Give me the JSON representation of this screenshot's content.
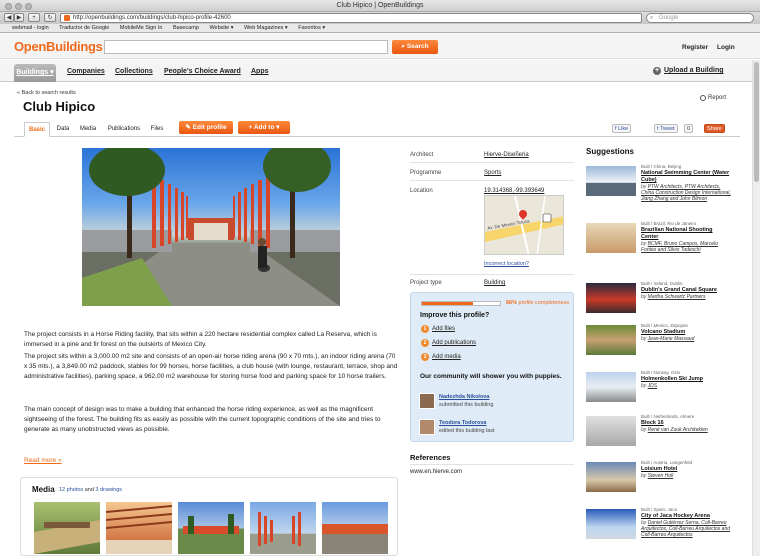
{
  "window": {
    "title": "Club Hipico | OpenBuildings"
  },
  "browser": {
    "url": "http://openbuildings.com/buildings/club-hipico-profile-42600",
    "search_placeholder": "Google",
    "bookmarks": [
      "webmail - login",
      "Traductor de Google",
      "MobileMe Sign In",
      "Basecamp",
      "Website ▾",
      "Web Magazines ▾",
      "Favoritos ▾"
    ]
  },
  "site": {
    "logo": "OpenBuildings",
    "search_label": "Search",
    "register": "Register",
    "login": "Login",
    "nav": [
      "Buildings",
      "Companies",
      "Collections",
      "People's Choice Award",
      "Apps"
    ],
    "upload": "Upload a Building"
  },
  "page": {
    "back": "« Back to search results",
    "title": "Club Hipico",
    "report": "Report",
    "tabs": [
      "Basic",
      "Data",
      "Media",
      "Publications",
      "Files"
    ],
    "edit_btn": "Edit profile",
    "add_btn": "Add to",
    "like": "Like",
    "tweet": "Tweet",
    "tweet_count": "0",
    "share": "Share"
  },
  "description": [
    "The project consists in a Horse Riding facility, that sits within a 220 hectare residential complex called La Reserva, which is immersed in a pine and fir forest on the outskirts of Mexico City.",
    "The project sits within a 3,000.00 m2 site and consists of an open-air horse riding arena (90 x 70 mts.), an indoor riding arena (70 x 35 mts.), a 3,849.00 m2 paddock, stables for 99 horses, horse facilities, a club house (with lounge, restaurant, terrace, shop and administrative facilities), parking space, a 962.00 m2 warehouse for storing horse food and parking space for 10 horse trailers.",
    "The main concept of design was to make a building that enhanced the horse riding experience, as well as the magnificent sightseeing of the forest. The building fits as easily as possible with the current topographic conditions of the site and tries to generate as many unobstructed views as possible."
  ],
  "read_more": "Read more »",
  "media": {
    "title": "Media",
    "photos_link": "12 photos",
    "and": "and",
    "drawings_link": "3 drawings"
  },
  "info": {
    "architect_label": "Architect",
    "architect": "Hierve-Diseñeria",
    "programme_label": "Programme",
    "programme": "Sports",
    "location_label": "Location",
    "location": "19.314368,-99.393649",
    "incorrect": "Incorrect location?",
    "map_text": "Av. De Mexico Toluca",
    "type_label": "Project type",
    "type": "Building"
  },
  "improve": {
    "percent": "66%",
    "percent_value": 66,
    "percent_label": "profile completeness",
    "title": "Improve this profile?",
    "items": [
      {
        "n": "1",
        "t": "Add files"
      },
      {
        "n": "2",
        "t": "Add publications"
      },
      {
        "n": "3",
        "t": "Add media"
      }
    ],
    "community": "Our community will shower you with puppies.",
    "users": [
      {
        "name": "Nadezhda Nikolova",
        "action": "submitted this building"
      },
      {
        "name": "Teodora Todorova",
        "action": "edited this building last"
      }
    ]
  },
  "references": {
    "title": "References",
    "url": "www.en.hierve.com"
  },
  "suggestions": {
    "title": "Suggestions",
    "items": [
      {
        "meta": "Built / China, Beijing",
        "name": "National Swimming Center (Water Cube)",
        "by": "by",
        "authors": "PTW Architects, PTW Architects, China Construction Design International, Jiang Zhang and John Bilmon"
      },
      {
        "meta": "Built / Brazil, Rio de Janeiro",
        "name": "Brazilian National Shooting Center",
        "by": "by",
        "authors": "BCMF, Bruno Campos, Marcelo Fontes and Silvio Todeschi"
      },
      {
        "meta": "Built / Ireland, Dublin",
        "name": "Dublin's Grand Canal Square",
        "by": "by",
        "authors": "Martha Schwartz Partners"
      },
      {
        "meta": "Built / Mexico, Zapopan",
        "name": "Volcano Stadium",
        "by": "by",
        "authors": "Jean-Marie Massaud"
      },
      {
        "meta": "Built / Norway, Oslo",
        "name": "Holmenkollen Ski Jump",
        "by": "by",
        "authors": "JDS"
      },
      {
        "meta": "Built / Netherlands, Almere",
        "name": "Block 16",
        "by": "by",
        "authors": "René van Zuuk Architekten"
      },
      {
        "meta": "Built / Austria, Langenfeld",
        "name": "Loisium Hotel",
        "by": "by",
        "authors": "Steven Holl"
      },
      {
        "meta": "Built / Spain, Jaca",
        "name": "City of Jaca Hockey Arena",
        "by": "by",
        "authors": "Daniel Gutiérrez Serna, Coll-Barreu Arquitectos, Coll-Barreu Arquitectos and Coll-Barreu Arquitectos"
      }
    ]
  },
  "colors": {
    "accent": "#f06a1d",
    "link": "#2a4f9a",
    "panel": "#dfecf7"
  }
}
